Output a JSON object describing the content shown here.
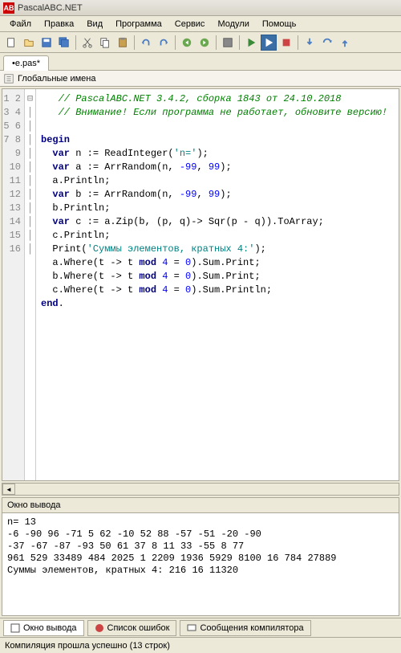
{
  "window": {
    "title": "PascalABC.NET",
    "icon_text": "AB"
  },
  "menu": {
    "items": [
      "Файл",
      "Правка",
      "Вид",
      "Программа",
      "Сервис",
      "Модули",
      "Помощь"
    ]
  },
  "tab": {
    "label": "•e.pas*"
  },
  "nav": {
    "label": "Глобальные имена"
  },
  "editor": {
    "lines": [
      "1",
      "2",
      "3",
      "4",
      "5",
      "6",
      "7",
      "8",
      "9",
      "10",
      "11",
      "12",
      "13",
      "14",
      "15",
      "16"
    ],
    "fold_line": 4,
    "fold_symbol": "⊟",
    "code": [
      {
        "t": "cm",
        "v": "   // PascalABC.NET 3.4.2, сборка 1843 от 24.10.2018"
      },
      {
        "t": "cm",
        "v": "   // Внимание! Если программа не работает, обновите версию!"
      },
      {
        "t": "",
        "v": ""
      },
      {
        "t": "mix",
        "parts": [
          {
            "t": "kw",
            "v": "begin"
          }
        ]
      },
      {
        "t": "mix",
        "parts": [
          {
            "t": "",
            "v": "  "
          },
          {
            "t": "kw",
            "v": "var"
          },
          {
            "t": "",
            "v": " n := ReadInteger("
          },
          {
            "t": "str",
            "v": "'n='"
          },
          {
            "t": "",
            "v": ");"
          }
        ]
      },
      {
        "t": "mix",
        "parts": [
          {
            "t": "",
            "v": "  "
          },
          {
            "t": "kw",
            "v": "var"
          },
          {
            "t": "",
            "v": " a := ArrRandom(n, "
          },
          {
            "t": "num",
            "v": "-99"
          },
          {
            "t": "",
            "v": ", "
          },
          {
            "t": "num",
            "v": "99"
          },
          {
            "t": "",
            "v": ");"
          }
        ]
      },
      {
        "t": "",
        "v": "  a.Println;"
      },
      {
        "t": "mix",
        "parts": [
          {
            "t": "",
            "v": "  "
          },
          {
            "t": "kw",
            "v": "var"
          },
          {
            "t": "",
            "v": " b := ArrRandom(n, "
          },
          {
            "t": "num",
            "v": "-99"
          },
          {
            "t": "",
            "v": ", "
          },
          {
            "t": "num",
            "v": "99"
          },
          {
            "t": "",
            "v": ");"
          }
        ]
      },
      {
        "t": "",
        "v": "  b.Println;"
      },
      {
        "t": "mix",
        "parts": [
          {
            "t": "",
            "v": "  "
          },
          {
            "t": "kw",
            "v": "var"
          },
          {
            "t": "",
            "v": " c := a.Zip(b, (p, q)-> Sqr(p - q)).ToArray;"
          }
        ]
      },
      {
        "t": "",
        "v": "  c.Println;"
      },
      {
        "t": "mix",
        "parts": [
          {
            "t": "",
            "v": "  Print("
          },
          {
            "t": "str",
            "v": "'Суммы элементов, кратных 4:'"
          },
          {
            "t": "",
            "v": ");"
          }
        ]
      },
      {
        "t": "mix",
        "parts": [
          {
            "t": "",
            "v": "  a.Where(t -> t "
          },
          {
            "t": "kw",
            "v": "mod"
          },
          {
            "t": "",
            "v": " "
          },
          {
            "t": "num",
            "v": "4"
          },
          {
            "t": "",
            "v": " = "
          },
          {
            "t": "num",
            "v": "0"
          },
          {
            "t": "",
            "v": ").Sum.Print;"
          }
        ]
      },
      {
        "t": "mix",
        "parts": [
          {
            "t": "",
            "v": "  b.Where(t -> t "
          },
          {
            "t": "kw",
            "v": "mod"
          },
          {
            "t": "",
            "v": " "
          },
          {
            "t": "num",
            "v": "4"
          },
          {
            "t": "",
            "v": " = "
          },
          {
            "t": "num",
            "v": "0"
          },
          {
            "t": "",
            "v": ").Sum.Print;"
          }
        ]
      },
      {
        "t": "mix",
        "parts": [
          {
            "t": "",
            "v": "  c.Where(t -> t "
          },
          {
            "t": "kw",
            "v": "mod"
          },
          {
            "t": "",
            "v": " "
          },
          {
            "t": "num",
            "v": "4"
          },
          {
            "t": "",
            "v": " = "
          },
          {
            "t": "num",
            "v": "0"
          },
          {
            "t": "",
            "v": ").Sum.Println;"
          }
        ]
      },
      {
        "t": "mix",
        "parts": [
          {
            "t": "kw",
            "v": "end"
          },
          {
            "t": "",
            "v": "."
          }
        ]
      }
    ]
  },
  "output_panel": {
    "header": "Окно вывода",
    "text": "n= 13\n-6 -90 96 -71 5 62 -10 52 88 -57 -51 -20 -90\n-37 -67 -87 -93 50 61 37 8 11 33 -55 8 77\n961 529 33489 484 2025 1 2209 1936 5929 8100 16 784 27889\nСуммы элементов, кратных 4: 216 16 11320"
  },
  "bottom_tabs": [
    {
      "label": "Окно вывода",
      "active": true
    },
    {
      "label": "Список ошибок",
      "active": false
    },
    {
      "label": "Сообщения компилятора",
      "active": false
    }
  ],
  "status": {
    "text": "Компиляция прошла успешно (13 строк)"
  }
}
